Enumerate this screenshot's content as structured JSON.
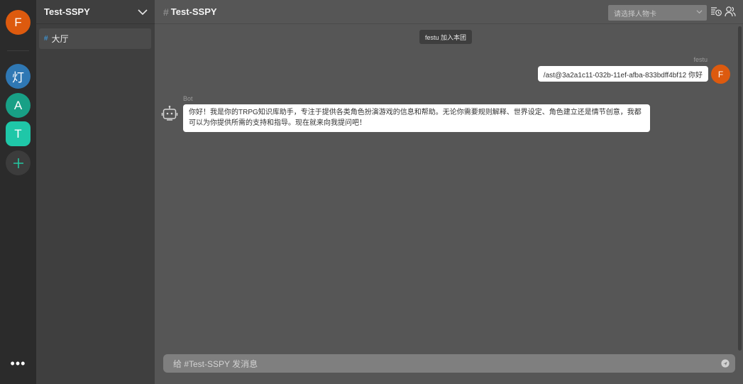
{
  "user": {
    "avatar_letter": "F",
    "avatar_color": "#dd5a0e"
  },
  "servers": [
    {
      "letter": "灯",
      "color": "#2f78b4"
    },
    {
      "letter": "A",
      "color": "#18a086"
    },
    {
      "letter": "T",
      "color": "#1fc7a8"
    }
  ],
  "add_server_icon": "plus-icon",
  "more_icon": "ellipsis-icon",
  "more_label": "•••",
  "sidebar": {
    "group_name": "Test-SSPY",
    "channels": [
      {
        "hash": "#",
        "name": "大厅",
        "active": true
      }
    ]
  },
  "header": {
    "hash": "#",
    "channel_title": "Test-SSPY",
    "character_select_placeholder": "请选择人物卡"
  },
  "messages": {
    "system_notice": "festu 加入本团",
    "outgoing": {
      "sender": "festu",
      "avatar_letter": "F",
      "text": "/ast@3a2a1c11-032b-11ef-afba-833bdff4bf12 你好"
    },
    "incoming": {
      "sender": "Bot",
      "avatar_icon": "robot-icon",
      "text": "你好！我是你的TRPG知识库助手，专注于提供各类角色扮演游戏的信息和帮助。无论你需要规则解释、世界设定、角色建立还是情节创意，我都可以为你提供所需的支持和指导。现在就来向我提问吧！"
    }
  },
  "composer": {
    "placeholder": "给 #Test-SSPY 发消息",
    "send_icon": "send-icon"
  },
  "colors": {
    "accent": "#3aa3f0",
    "brand_orange": "#dd5a0e",
    "add_green": "#24c7a1"
  }
}
